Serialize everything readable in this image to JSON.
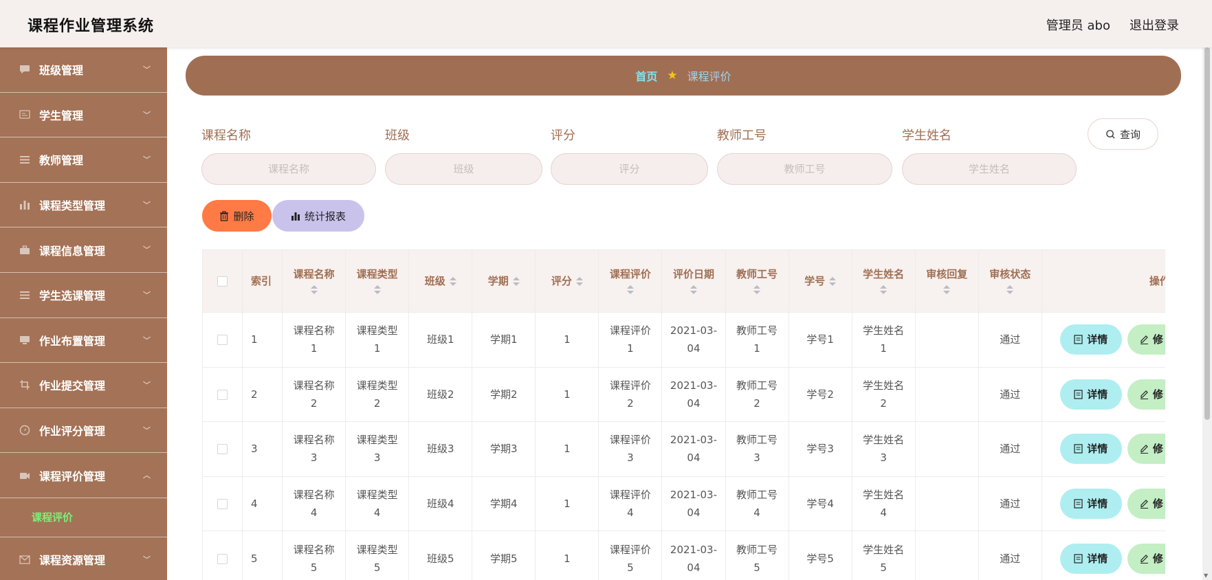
{
  "header": {
    "title": "课程作业管理系统",
    "admin_label": "管理员 abo",
    "logout_label": "退出登录"
  },
  "sidebar": {
    "items": [
      {
        "label": "班级管理",
        "icon": "chat-icon"
      },
      {
        "label": "学生管理",
        "icon": "id-card-icon"
      },
      {
        "label": "教师管理",
        "icon": "list-icon"
      },
      {
        "label": "课程类型管理",
        "icon": "bar-chart-icon"
      },
      {
        "label": "课程信息管理",
        "icon": "briefcase-icon"
      },
      {
        "label": "学生选课管理",
        "icon": "list-icon"
      },
      {
        "label": "作业布置管理",
        "icon": "monitor-icon"
      },
      {
        "label": "作业提交管理",
        "icon": "crop-icon"
      },
      {
        "label": "作业评分管理",
        "icon": "compass-icon"
      },
      {
        "label": "课程评价管理",
        "icon": "video-icon"
      },
      {
        "label": "课程资源管理",
        "icon": "mail-icon"
      }
    ],
    "active_sub": "课程评价"
  },
  "breadcrumb": {
    "home": "首页",
    "current": "课程评价"
  },
  "search": {
    "fields": [
      {
        "label": "课程名称",
        "placeholder": "课程名称"
      },
      {
        "label": "班级",
        "placeholder": "班级"
      },
      {
        "label": "评分",
        "placeholder": "评分"
      },
      {
        "label": "教师工号",
        "placeholder": "教师工号"
      },
      {
        "label": "学生姓名",
        "placeholder": "学生姓名"
      }
    ],
    "query_label": "查询"
  },
  "actions": {
    "delete_label": "删除",
    "stats_label": "统计报表"
  },
  "table": {
    "columns": [
      "索引",
      "课程名称",
      "课程类型",
      "班级",
      "学期",
      "评分",
      "课程评价",
      "评价日期",
      "教师工号",
      "学号",
      "学生姓名",
      "审核回复",
      "审核状态",
      "操作"
    ],
    "rows": [
      {
        "idx": "1",
        "name": "课程名称1",
        "type": "课程类型1",
        "cls": "班级1",
        "term": "学期1",
        "score": "1",
        "review": "课程评价1",
        "date": "2021-03-04",
        "teacher": "教师工号1",
        "sid": "学号1",
        "student": "学生姓名1",
        "reply": "",
        "status": "通过"
      },
      {
        "idx": "2",
        "name": "课程名称2",
        "type": "课程类型2",
        "cls": "班级2",
        "term": "学期2",
        "score": "1",
        "review": "课程评价2",
        "date": "2021-03-04",
        "teacher": "教师工号2",
        "sid": "学号2",
        "student": "学生姓名2",
        "reply": "",
        "status": "通过"
      },
      {
        "idx": "3",
        "name": "课程名称3",
        "type": "课程类型3",
        "cls": "班级3",
        "term": "学期3",
        "score": "1",
        "review": "课程评价3",
        "date": "2021-03-04",
        "teacher": "教师工号3",
        "sid": "学号3",
        "student": "学生姓名3",
        "reply": "",
        "status": "通过"
      },
      {
        "idx": "4",
        "name": "课程名称4",
        "type": "课程类型4",
        "cls": "班级4",
        "term": "学期4",
        "score": "1",
        "review": "课程评价4",
        "date": "2021-03-04",
        "teacher": "教师工号4",
        "sid": "学号4",
        "student": "学生姓名4",
        "reply": "",
        "status": "通过"
      },
      {
        "idx": "5",
        "name": "课程名称5",
        "type": "课程类型5",
        "cls": "班级5",
        "term": "学期5",
        "score": "1",
        "review": "课程评价5",
        "date": "2021-03-04",
        "teacher": "教师工号5",
        "sid": "学号5",
        "student": "学生姓名5",
        "reply": "",
        "status": "通过"
      }
    ],
    "detail_label": "详情",
    "edit_label": "修"
  }
}
